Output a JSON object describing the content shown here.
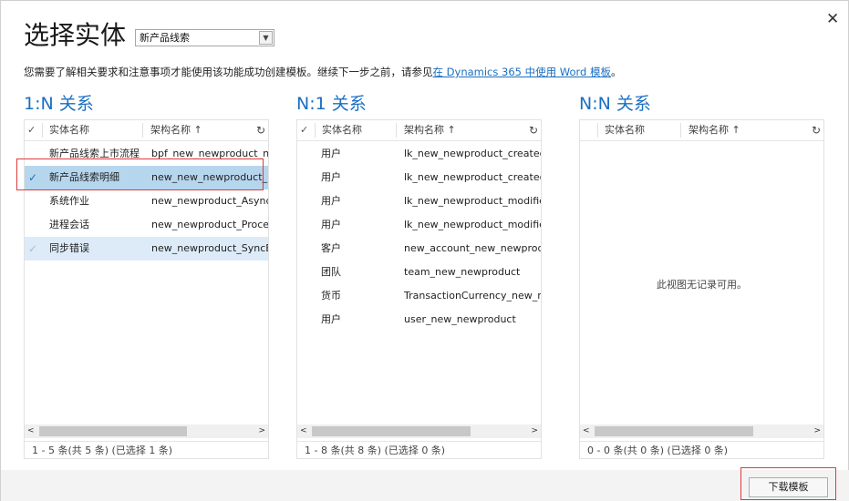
{
  "dialog": {
    "title": "选择实体",
    "close_glyph": "✕",
    "entity_select": {
      "value": "新产品线索",
      "arrow": "▼"
    },
    "description_prefix": "您需要了解相关要求和注意事项才能使用该功能成功创建模板。继续下一步之前，请参见",
    "description_link": "在 Dynamics 365 中使用 Word 模板",
    "description_suffix": "。",
    "download_button": "下载模板"
  },
  "header_labels": {
    "entity_name": "实体名称",
    "schema_name": "架构名称 ↑",
    "check": "✓",
    "refresh": "↻"
  },
  "scroll": {
    "left": "<",
    "right": ">"
  },
  "one_to_n": {
    "title": "1:N 关系",
    "rows": [
      {
        "entity": "新产品线索上市流程",
        "schema": "bpf_new_newproduct_new_",
        "state": "normal"
      },
      {
        "entity": "新产品线索明细",
        "schema": "new_new_newproduct_new",
        "state": "selected"
      },
      {
        "entity": "系统作业",
        "schema": "new_newproduct_AsyncOp",
        "state": "normal"
      },
      {
        "entity": "进程会话",
        "schema": "new_newproduct_ProcessSe",
        "state": "normal"
      },
      {
        "entity": "同步错误",
        "schema": "new_newproduct_SyncError",
        "state": "hover"
      }
    ],
    "footer": "1 - 5 条(共 5 条) (已选择 1 条)"
  },
  "n_to_one": {
    "title": "N:1 关系",
    "rows": [
      {
        "entity": "用户",
        "schema": "lk_new_newproduct_createdby"
      },
      {
        "entity": "用户",
        "schema": "lk_new_newproduct_createdonbe..."
      },
      {
        "entity": "用户",
        "schema": "lk_new_newproduct_modifiedby"
      },
      {
        "entity": "用户",
        "schema": "lk_new_newproduct_modifiedonb..."
      },
      {
        "entity": "客户",
        "schema": "new_account_new_newproduct_n..."
      },
      {
        "entity": "团队",
        "schema": "team_new_newproduct"
      },
      {
        "entity": "货币",
        "schema": "TransactionCurrency_new_newpr..."
      },
      {
        "entity": "用户",
        "schema": "user_new_newproduct"
      }
    ],
    "footer": "1 - 8 条(共 8 条) (已选择 0 条)"
  },
  "n_to_n": {
    "title": "N:N 关系",
    "empty_text": "此视图无记录可用。",
    "footer": "0 - 0 条(共 0 条) (已选择 0 条)"
  },
  "colors": {
    "accent": "#1b6fc2",
    "selected_row": "#b6d6ee",
    "hover_row": "#dcebf7",
    "highlight_box": "#e03a3a"
  }
}
